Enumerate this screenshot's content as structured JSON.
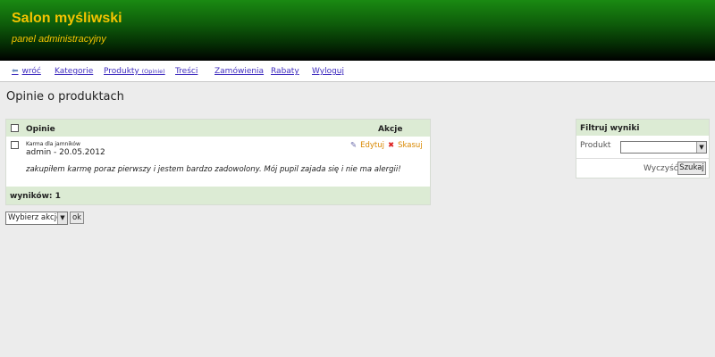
{
  "header": {
    "title": "Salon myśliwski",
    "subtitle": "panel administracyjny"
  },
  "nav": {
    "back": "wróć",
    "categories": "Kategorie",
    "products": "Produkty",
    "products_sub": "(Opinie)",
    "content": "Treści",
    "orders": "Zamówienia",
    "discounts": "Rabaty",
    "logout": "Wyloguj"
  },
  "page": {
    "title": "Opinie o produktach"
  },
  "reviews_table": {
    "col_reviews": "Opinie",
    "col_actions": "Akcje",
    "rows": [
      {
        "product": "Karma dla jamników",
        "meta": "admin - 20.05.2012",
        "text": "zakupiłem karmę poraz pierwszy i jestem bardzo zadowolony. Mój pupil zajada się i nie ma alergii!",
        "edit": "Edytuj",
        "delete": "Skasuj"
      }
    ],
    "footer": "wyników: 1"
  },
  "bulk": {
    "selected": "Wybierz akcję",
    "ok": "ok"
  },
  "filter": {
    "title": "Filtruj wyniki",
    "product_label": "Produkt",
    "product_value": "",
    "clear": "Wyczyść",
    "search": "Szukaj"
  },
  "colors": {
    "header_green": "#0e5c0a",
    "title_yellow": "#f4c400",
    "panel_head": "#dcebd4",
    "link": "#3f2cbf",
    "action": "#d98800"
  }
}
